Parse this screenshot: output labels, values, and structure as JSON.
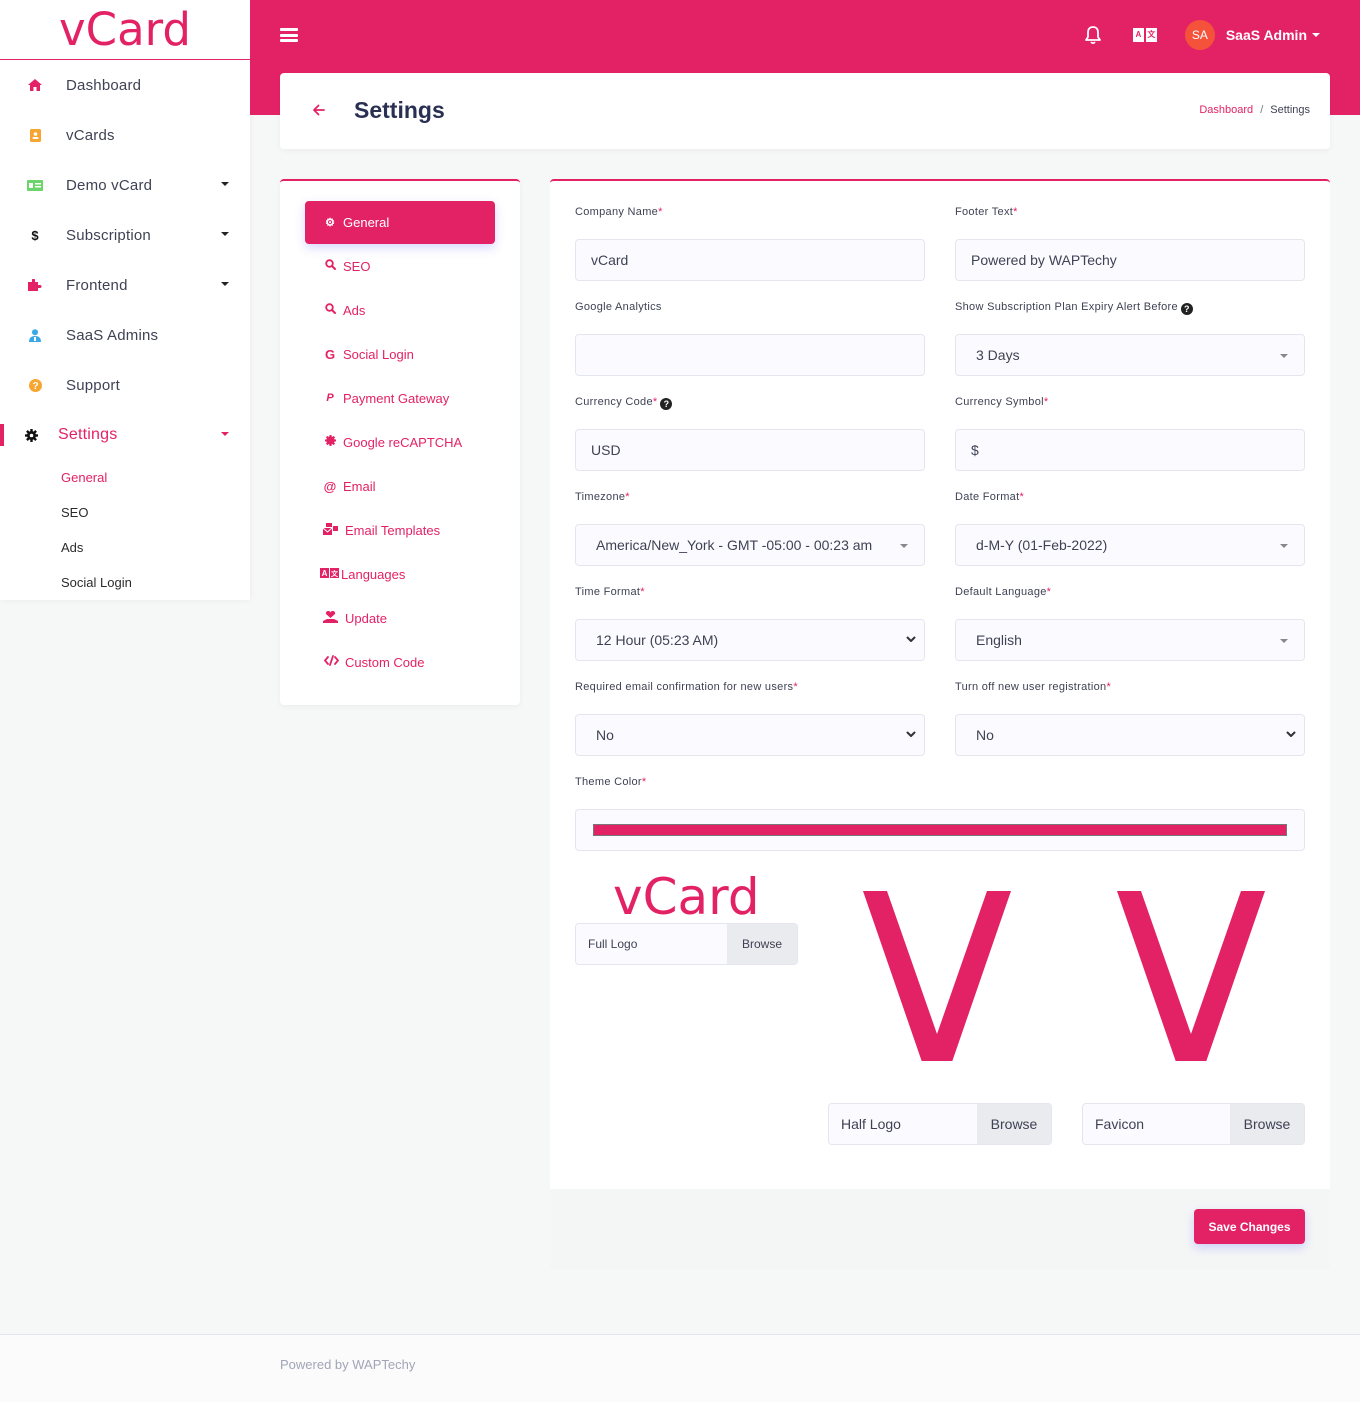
{
  "app": {
    "brand": "vCard",
    "theme_color": "#e32265"
  },
  "topbar": {
    "user_initials": "SA",
    "user_name": "SaaS Admin",
    "icons": [
      "menu-icon",
      "bell-icon",
      "language-icon"
    ]
  },
  "sidebar": {
    "items": [
      {
        "label": "Dashboard",
        "icon": "home-icon",
        "has_caret": false
      },
      {
        "label": "vCards",
        "icon": "contact-book-icon",
        "has_caret": false
      },
      {
        "label": "Demo vCard",
        "icon": "id-card-icon",
        "has_caret": true
      },
      {
        "label": "Subscription",
        "icon": "dollar-icon",
        "has_caret": true
      },
      {
        "label": "Frontend",
        "icon": "puzzle-icon",
        "has_caret": true
      },
      {
        "label": "SaaS Admins",
        "icon": "user-tie-icon",
        "has_caret": false
      },
      {
        "label": "Support",
        "icon": "question-circle-icon",
        "has_caret": false
      },
      {
        "label": "Settings",
        "icon": "gear-icon",
        "has_caret": true,
        "active": true
      }
    ],
    "settings_submenu": [
      "General",
      "SEO",
      "Ads",
      "Social Login"
    ],
    "settings_submenu_active": "General"
  },
  "header": {
    "title": "Settings",
    "breadcrumb": [
      "Dashboard",
      "Settings"
    ]
  },
  "settings_nav": [
    {
      "label": "General",
      "icon": "cogs-icon",
      "active": true
    },
    {
      "label": "SEO",
      "icon": "search-icon"
    },
    {
      "label": "Ads",
      "icon": "search-icon"
    },
    {
      "label": "Social Login",
      "icon": "google-icon"
    },
    {
      "label": "Payment Gateway",
      "icon": "paypal-icon"
    },
    {
      "label": "Google reCAPTCHA",
      "icon": "certificate-icon"
    },
    {
      "label": "Email",
      "icon": "at-icon"
    },
    {
      "label": "Email Templates",
      "icon": "mail-bulk-icon"
    },
    {
      "label": "Languages",
      "icon": "language-icon"
    },
    {
      "label": "Update",
      "icon": "hand-holding-heart-icon"
    },
    {
      "label": "Custom Code",
      "icon": "code-icon"
    }
  ],
  "form": {
    "company_name": {
      "label": "Company Name",
      "required": true,
      "value": "vCard"
    },
    "footer_text": {
      "label": "Footer Text",
      "required": true,
      "value": "Powered by WAPTechy"
    },
    "google_analytics": {
      "label": "Google Analytics",
      "required": false,
      "value": ""
    },
    "expiry_alert": {
      "label": "Show Subscription Plan Expiry Alert Before",
      "required": false,
      "help": true,
      "value": "3 Days"
    },
    "currency_code": {
      "label": "Currency Code",
      "required": true,
      "help": true,
      "value": "USD"
    },
    "currency_symbol": {
      "label": "Currency Symbol",
      "required": true,
      "value": "$"
    },
    "timezone": {
      "label": "Timezone",
      "required": true,
      "value": "America/New_York - GMT -05:00 - 00:23 am"
    },
    "date_format": {
      "label": "Date Format",
      "required": true,
      "value": "d-M-Y (01-Feb-2022)"
    },
    "time_format": {
      "label": "Time Format",
      "required": true,
      "value": "12 Hour (05:23 AM)"
    },
    "default_language": {
      "label": "Default Language",
      "required": true,
      "value": "English"
    },
    "email_confirmation": {
      "label": "Required email confirmation for new users",
      "required": true,
      "value": "No"
    },
    "turn_off_registration": {
      "label": "Turn off new user registration",
      "required": true,
      "value": "No"
    },
    "theme_color": {
      "label": "Theme Color",
      "required": true,
      "value": "#e32265"
    },
    "full_logo": {
      "preview_text": "vCard",
      "label": "Full Logo",
      "browse": "Browse"
    },
    "half_logo": {
      "preview_text": "V",
      "label": "Half Logo",
      "browse": "Browse"
    },
    "favicon": {
      "preview_text": "V",
      "label": "Favicon",
      "browse": "Browse"
    },
    "required_mark": "*",
    "help_mark": "?",
    "save_label": "Save Changes"
  },
  "footer": {
    "text": "Powered by WAPTechy"
  }
}
